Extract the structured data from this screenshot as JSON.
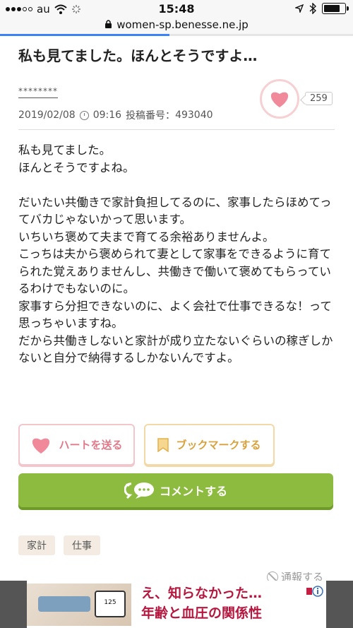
{
  "status_bar": {
    "carrier": "au",
    "time": "15:48"
  },
  "url_bar": {
    "domain": "women-sp.benesse.ne.jp"
  },
  "post": {
    "title": "私も見てました。ほんとそうですよ…",
    "author": "********",
    "date": "2019/02/08",
    "time": "09:16",
    "post_number_label": "投稿番号：",
    "post_number": "493040",
    "heart_count": "259",
    "body": "私も見てました。\nほんとそうですよね。\n\nだいたい共働きで家計負担してるのに、家事したらほめてってバカじゃないかって思います。\nいちいち褒めて夫まで育てる余裕ありませんよ。\nこっちは夫から褒められて妻として家事をできるように育てられた覚えありませんし、共働きで働いて褒めてもらっているわけでもないのに。\n家事すら分担できないのに、よく会社で仕事できるな！って思っちゃいますね。\nだから共働きしないと家計が成り立たないぐらいの稼ぎしかないと自分で納得するしかないんですよ。"
  },
  "actions": {
    "send_heart_label": "ハートを送る",
    "bookmark_label": "ブックマークする",
    "comment_label": "コメントする"
  },
  "tags": [
    "家計",
    "仕事"
  ],
  "report_label": "通報する",
  "ad": {
    "line1": "え、知らなかった…",
    "line2": "年齢と血圧の関係性",
    "monitor_reading": "125"
  },
  "colors": {
    "heart_pink": "#f08a9a",
    "bookmark_gold": "#e2b04a",
    "comment_green": "#8dbb3f",
    "ad_red": "#b5173f"
  }
}
